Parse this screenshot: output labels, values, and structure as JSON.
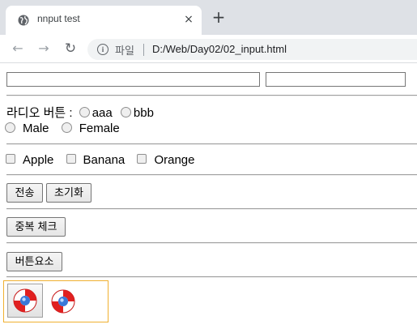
{
  "browser": {
    "tab_title": "nnput test",
    "tab_close": "×",
    "new_tab": "+",
    "site_label": "파일",
    "url": "D:/Web/Day02/02_input.html"
  },
  "form": {
    "text1_value": "",
    "text2_value": "",
    "radio_label": "라디오 버튼 :",
    "radio_options": [
      "aaa",
      "bbb"
    ],
    "gender_options": [
      "Male",
      "Female"
    ],
    "fruits": [
      "Apple",
      "Banana",
      "Orange"
    ],
    "submit_label": "전송",
    "reset_label": "초기화",
    "dupcheck_label": "중복 체크",
    "button_element_label": "버튼요소"
  },
  "icons": {
    "favicon": "globe-icon",
    "back": "arrow-left-icon",
    "forward": "arrow-right-icon",
    "reload": "reload-icon",
    "info": "info-icon",
    "image_button": "lifebuoy-icon"
  },
  "colors": {
    "tabstrip": "#dee1e6",
    "image_area_border": "#f0b030",
    "lifebuoy_red": "#e02020"
  }
}
